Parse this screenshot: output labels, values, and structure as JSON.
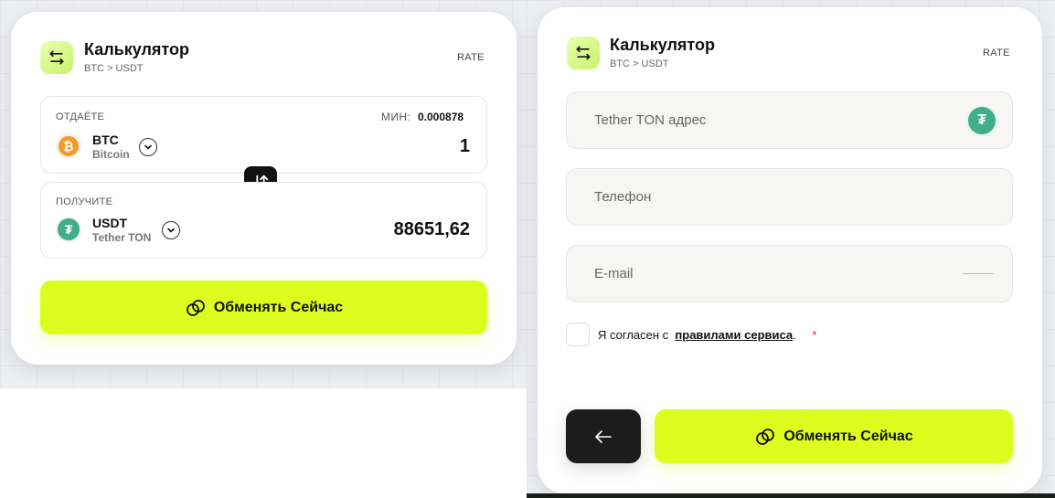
{
  "left": {
    "header": {
      "title": "Калькулятор",
      "pair": "BTC > USDT",
      "rate_label": "RATE"
    },
    "give": {
      "label": "ОТДАЁТЕ",
      "min_label": "МИН:",
      "min_value": "0.000878",
      "coin_symbol": "BTC",
      "coin_network": "Bitcoin",
      "amount": "1"
    },
    "receive": {
      "label": "ПОЛУЧИТЕ",
      "coin_symbol": "USDT",
      "coin_network": "Tether TON",
      "amount": "88651,62"
    },
    "exchange_button": "Обменять Сейчас"
  },
  "right": {
    "header": {
      "title": "Калькулятор",
      "pair": "BTC > USDT",
      "rate_label": "RATE"
    },
    "fields": {
      "address_placeholder": "Tether TON адрес",
      "phone_placeholder": "Телефон",
      "email_placeholder": "E-mail"
    },
    "agreement": {
      "prefix": "Я согласен с",
      "link": "правилами сервиса",
      "suffix": ".",
      "required_mark": "*"
    },
    "exchange_button": "Обменять Сейчас"
  },
  "colors": {
    "accent": "#dcfe1e",
    "dark": "#1c1c1c",
    "btc": "#f39a2a",
    "usdt": "#3fae8a"
  },
  "icons": {
    "header": "swap-horizontal-icon",
    "swap": "swap-vertical-icon",
    "exchange": "exchange-rings-icon",
    "back": "arrow-left-icon"
  }
}
